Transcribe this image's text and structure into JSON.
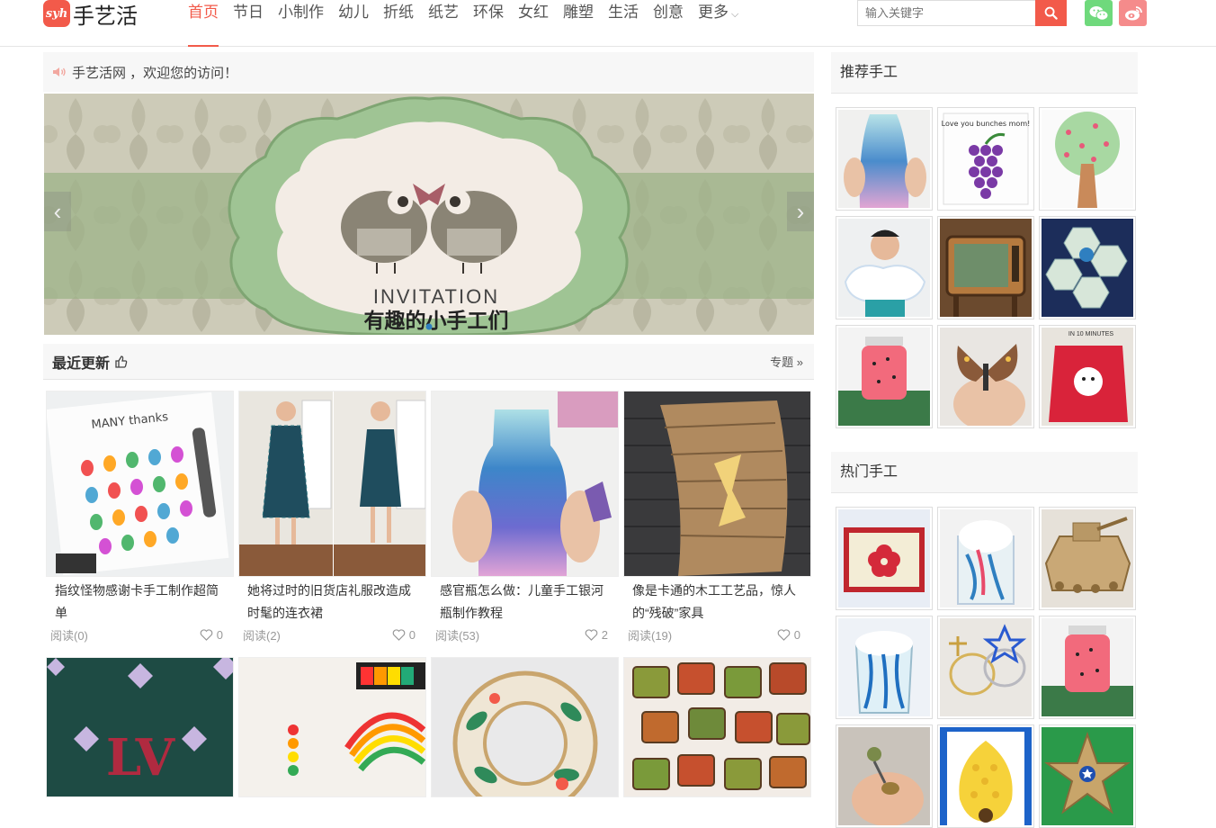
{
  "logo": {
    "badge": "syh",
    "text": "手艺活"
  },
  "nav": {
    "items": [
      "首页",
      "节日",
      "小制作",
      "幼儿",
      "折纸",
      "纸艺",
      "环保",
      "女红",
      "雕塑",
      "生活",
      "创意"
    ],
    "more_label": "更多"
  },
  "search": {
    "placeholder": "输入关键字"
  },
  "notice": {
    "text": "手艺活网 ，欢迎您的访问！"
  },
  "banner": {
    "heading": "INVITATION",
    "subheading": "有趣的小手工们"
  },
  "latest": {
    "title": "最近更新",
    "link_label": "专题",
    "cards": [
      {
        "title": "指纹怪物感谢卡手工制作超简单",
        "reads": "阅读(0)",
        "likes": "0"
      },
      {
        "title": "她将过时的旧货店礼服改造成时髦的连衣裙",
        "reads": "阅读(2)",
        "likes": "0"
      },
      {
        "title": "感官瓶怎么做：儿童手工银河瓶制作教程",
        "reads": "阅读(53)",
        "likes": "2"
      },
      {
        "title": "像是卡通的木工工艺品，惊人的“残破”家具",
        "reads": "阅读(19)",
        "likes": "0"
      }
    ]
  },
  "thumb_text": {
    "card1": "MANY thanks",
    "rec2": "Love you bunches mom!",
    "rec9": "IN 10 MINUTES"
  },
  "sidebar": {
    "recommended_title": "推荐手工",
    "hot_title": "热门手工"
  },
  "colors": {
    "accent": "#f25a4a",
    "wechat": "#6fd97c",
    "weibo": "#f58b8b"
  }
}
